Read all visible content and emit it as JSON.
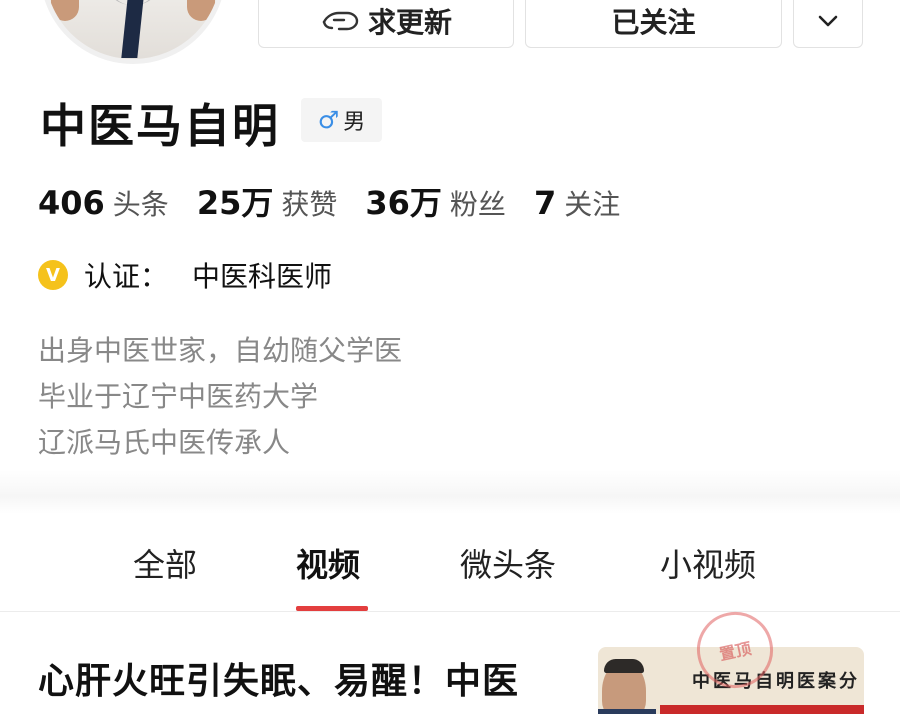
{
  "profile": {
    "name": "中医马自明",
    "gender_symbol": "♂",
    "gender_label": "男",
    "verification_label": "认证：",
    "verification_value": "中医科医师",
    "bio": [
      "出身中医世家，自幼随父学医",
      "毕业于辽宁中医药大学",
      "辽派马氏中医传承人"
    ]
  },
  "actions": {
    "request_update": "求更新",
    "followed": "已关注",
    "more_icon": "chevron-down-icon"
  },
  "stats": [
    {
      "value": "406",
      "label": "头条"
    },
    {
      "value": "25万",
      "label": "获赞"
    },
    {
      "value": "36万",
      "label": "粉丝"
    },
    {
      "value": "7",
      "label": "关注"
    }
  ],
  "verify_badge": "V",
  "tabs": [
    {
      "label": "全部",
      "active": false
    },
    {
      "label": "视频",
      "active": true
    },
    {
      "label": "微头条",
      "active": false
    },
    {
      "label": "小视频",
      "active": false
    }
  ],
  "feed": {
    "first_title": "心肝火旺引失眠、易醒！中医",
    "thumb_caption": "中医马自明医案分",
    "stamp_text": "置顶"
  },
  "colors": {
    "accent": "#e33e3e",
    "verify": "#f5c21b",
    "male": "#3a8ee6"
  }
}
